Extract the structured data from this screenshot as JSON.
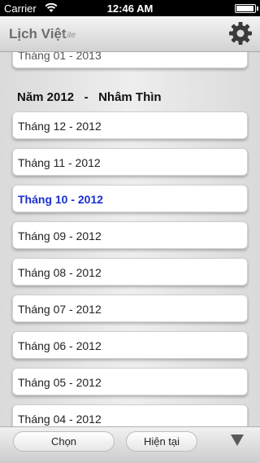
{
  "status_bar": {
    "carrier": "Carrier",
    "time": "12:46 AM",
    "battery_level": 0.95
  },
  "nav": {
    "title": "Lịch Việt",
    "subtitle": "Lite",
    "settings_icon": "gear-icon"
  },
  "partial_row": {
    "label": "Tháng 01 - 2013"
  },
  "year_header": {
    "year": "Năm 2012",
    "separator": "-",
    "name": "Nhâm Thìn"
  },
  "months": [
    {
      "label": "Tháng 12 - 2012",
      "selected": false
    },
    {
      "label": "Tháng 11 - 2012",
      "selected": false
    },
    {
      "label": "Tháng 10 - 2012",
      "selected": true
    },
    {
      "label": "Tháng 09 - 2012",
      "selected": false
    },
    {
      "label": "Tháng 08 - 2012",
      "selected": false
    },
    {
      "label": "Tháng 07 - 2012",
      "selected": false
    },
    {
      "label": "Tháng 06 - 2012",
      "selected": false
    },
    {
      "label": "Tháng 05 - 2012",
      "selected": false
    },
    {
      "label": "Tháng 04 - 2012",
      "selected": false
    }
  ],
  "toolbar": {
    "choose_label": "Chọn",
    "current_label": "Hiện tại",
    "down_icon": "triangle-down-icon"
  },
  "colors": {
    "selected_text": "#1a2fd0",
    "status_bar_bg": "#000000"
  }
}
